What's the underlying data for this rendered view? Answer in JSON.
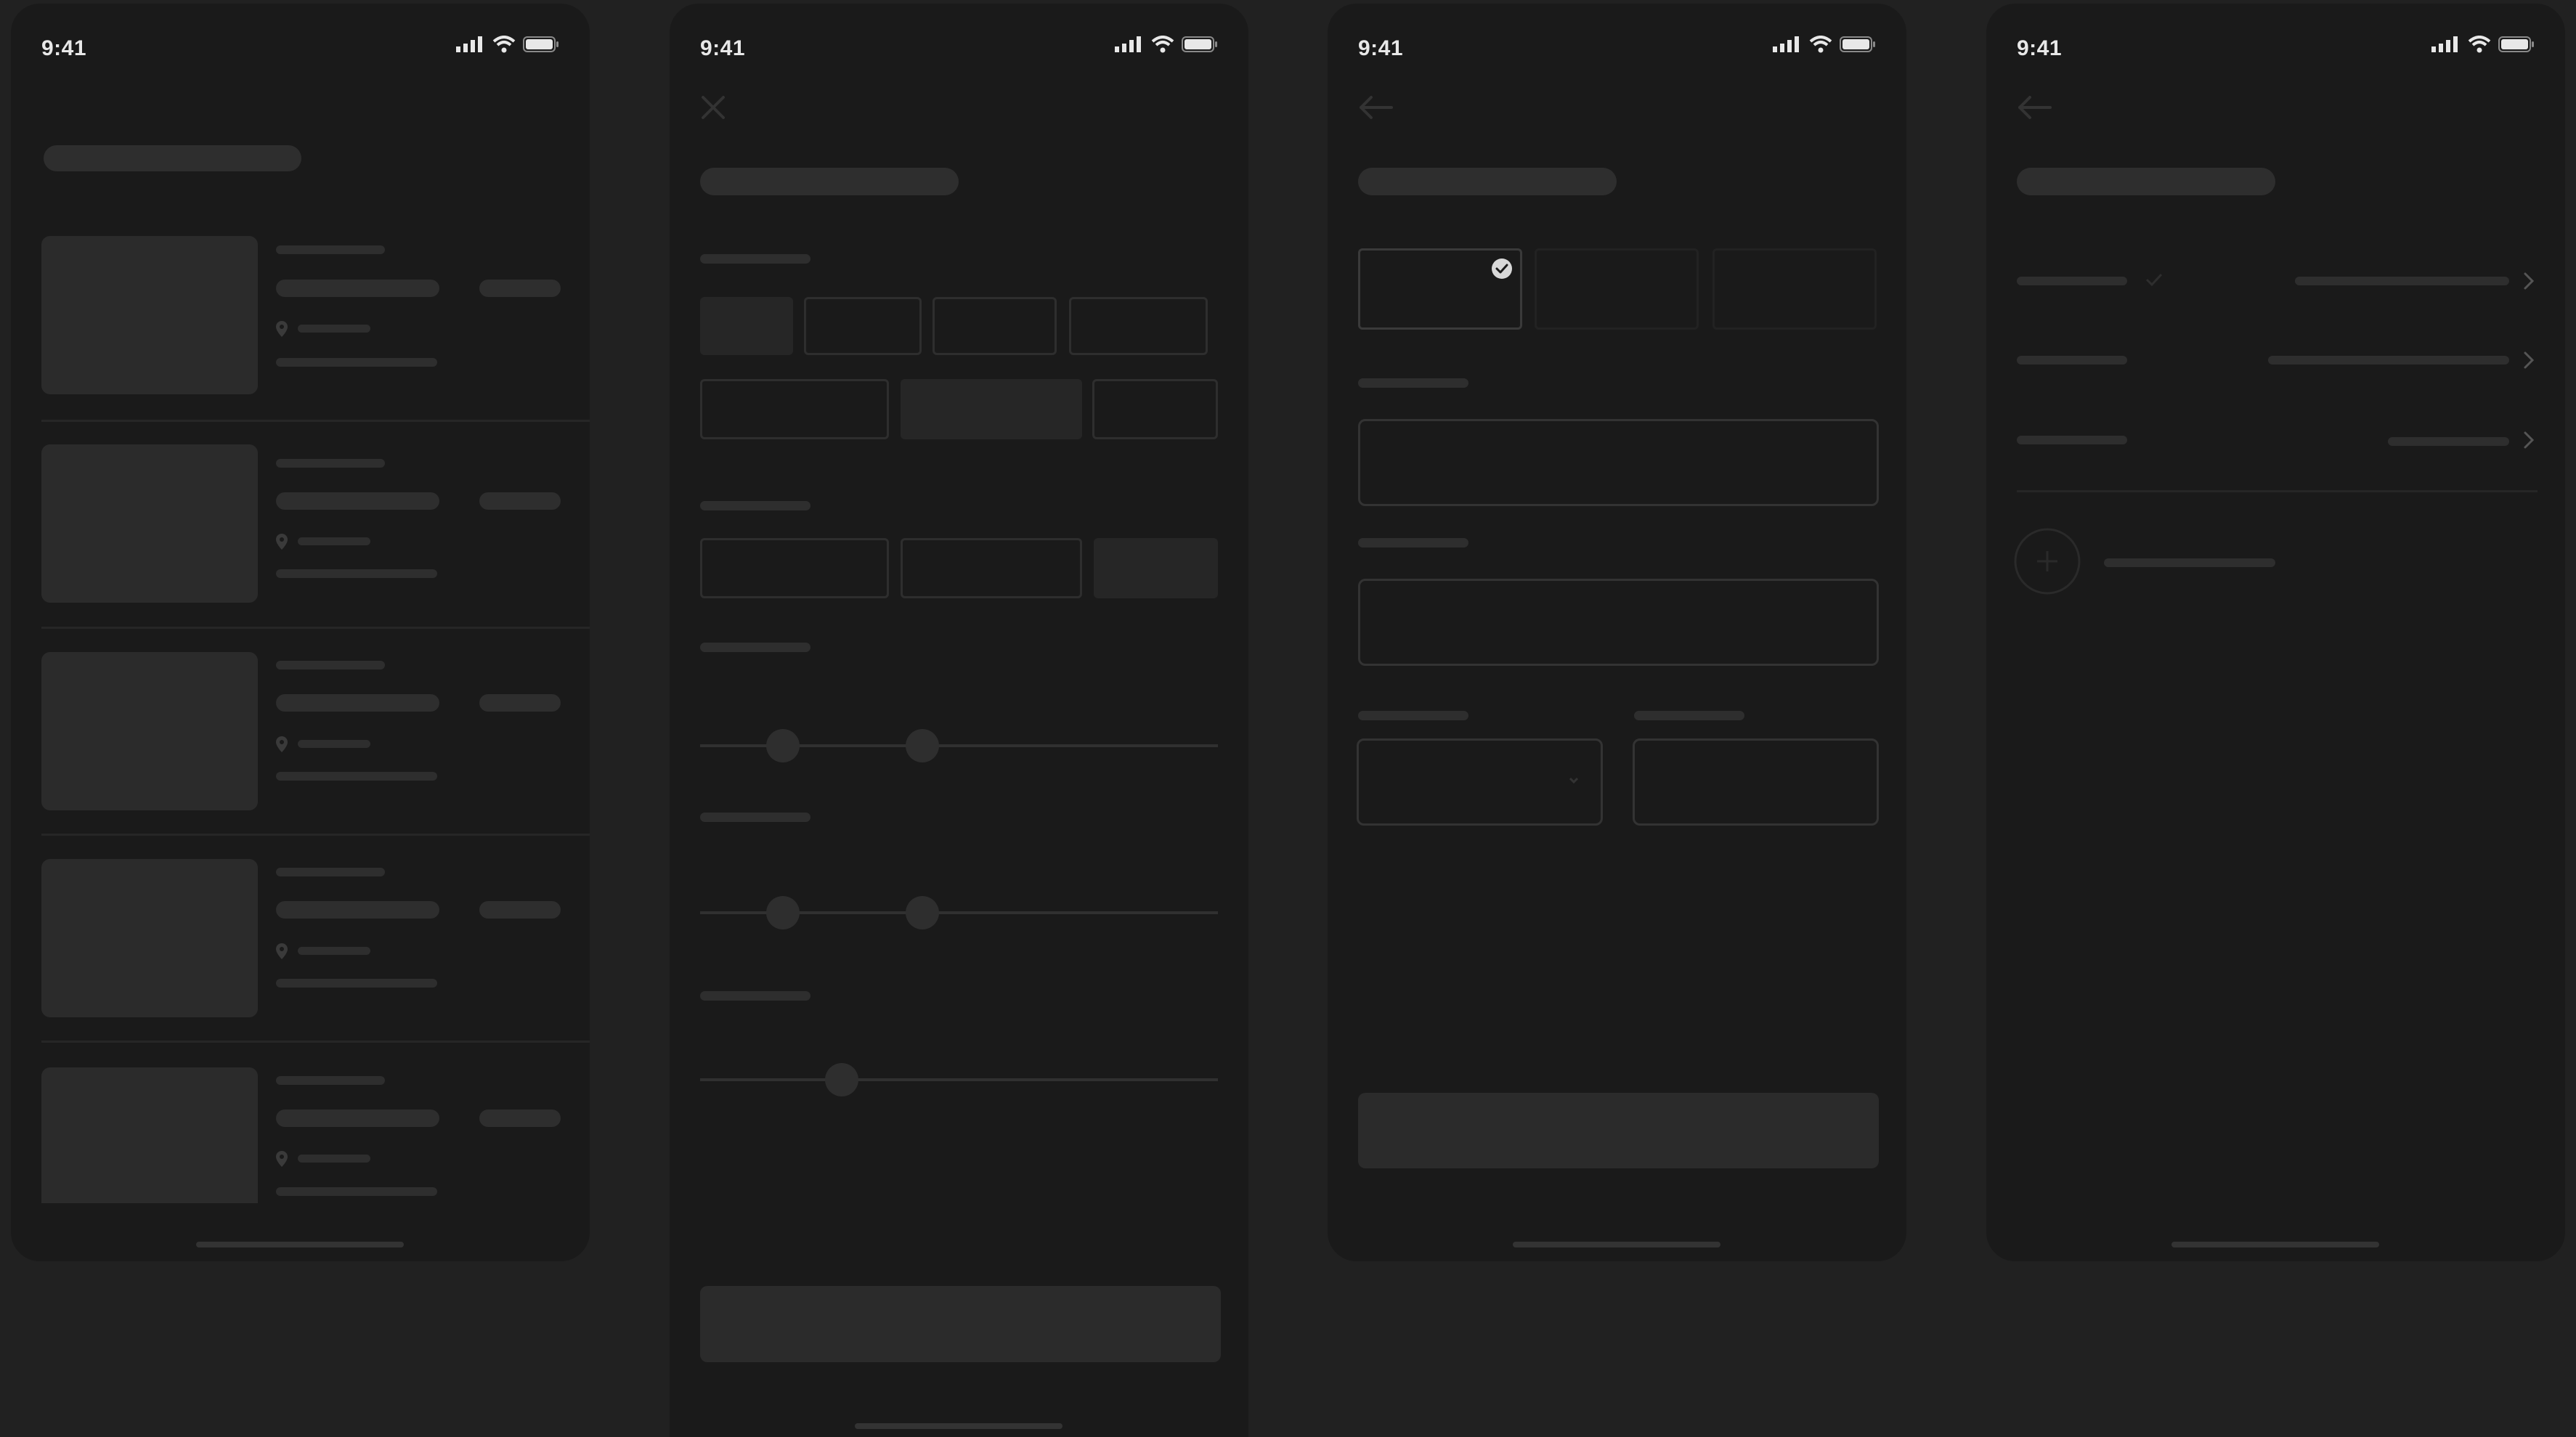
{
  "screens": [
    {
      "status_time": "9:41"
    },
    {
      "status_time": "9:41"
    },
    {
      "status_time": "9:41"
    },
    {
      "status_time": "9:41"
    }
  ],
  "colors": {
    "background": "#212121",
    "screen": "#1a1a1a",
    "skeleton": "#2e2e2e",
    "status_text": "#e8e8e8"
  },
  "icons": [
    "signal-icon",
    "wifi-icon",
    "battery-icon",
    "location-pin-icon",
    "close-icon",
    "back-arrow-icon",
    "check-icon",
    "chevron-right-icon",
    "chevron-down-icon",
    "plus-icon"
  ]
}
